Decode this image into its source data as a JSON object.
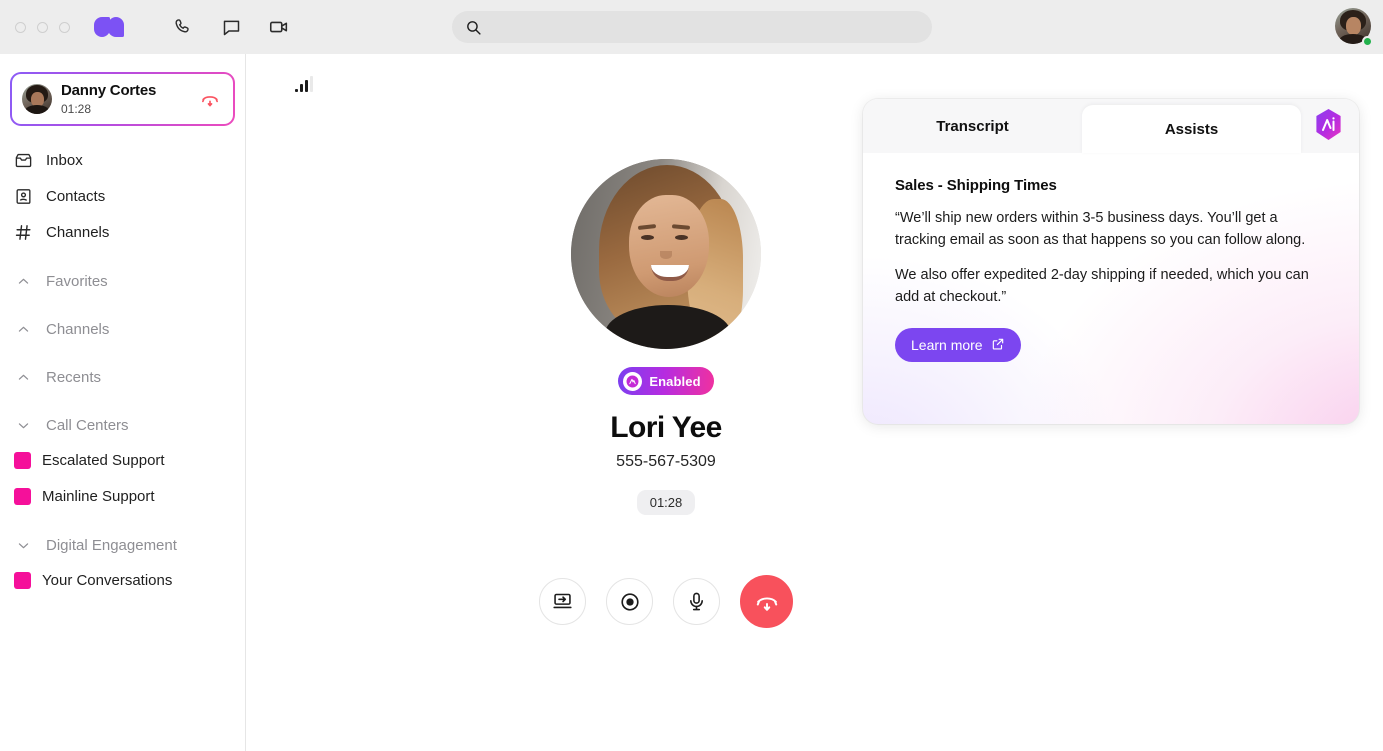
{
  "window": {
    "traffic_lights": [
      "close",
      "minimize",
      "zoom"
    ],
    "logo_name": "dialpad-logo"
  },
  "topbar": {
    "icons": [
      {
        "name": "phone-icon",
        "label": "Phone"
      },
      {
        "name": "message-icon",
        "label": "Messages"
      },
      {
        "name": "video-icon",
        "label": "Video"
      }
    ],
    "search": {
      "value": "",
      "placeholder": ""
    },
    "account": {
      "name": "account-avatar",
      "status": "online",
      "status_color": "#22b14c"
    }
  },
  "sidebar": {
    "active_call": {
      "name": "Danny Cortes",
      "duration": "01:28",
      "end_call_label": "End call"
    },
    "nav": [
      {
        "icon": "inbox-icon",
        "label": "Inbox"
      },
      {
        "icon": "contacts-icon",
        "label": "Contacts"
      },
      {
        "icon": "hash-icon",
        "label": "Channels"
      }
    ],
    "sections": [
      {
        "label": "Favorites",
        "state": "collapsed",
        "chevron": "chevron-up-icon",
        "items": []
      },
      {
        "label": "Channels",
        "state": "collapsed",
        "chevron": "chevron-up-icon",
        "items": []
      },
      {
        "label": "Recents",
        "state": "collapsed",
        "chevron": "chevron-up-icon",
        "items": []
      },
      {
        "label": "Call Centers",
        "state": "expanded",
        "chevron": "chevron-down-icon",
        "items": [
          {
            "label": "Escalated Support",
            "color": "#f5109a"
          },
          {
            "label": "Mainline Support",
            "color": "#f5109a"
          }
        ]
      },
      {
        "label": "Digital Engagement",
        "state": "expanded",
        "chevron": "chevron-down-icon",
        "items": [
          {
            "label": "Your Conversations",
            "color": "#f5109a"
          }
        ]
      }
    ]
  },
  "call": {
    "signal_icon": "signal-strength-icon",
    "signal_bars_filled": 3,
    "signal_bars_total": 4,
    "avatar_name": "caller-avatar",
    "badge": {
      "label": "Enabled",
      "icon": "ai-badge-icon"
    },
    "caller_name": "Lori Yee",
    "phone": "555-567-5309",
    "timer": "01:28",
    "controls": [
      {
        "name": "transfer-call-button",
        "icon": "screen-transfer-icon",
        "label": "Transfer"
      },
      {
        "name": "record-call-button",
        "icon": "record-icon",
        "label": "Record"
      },
      {
        "name": "mute-button",
        "icon": "microphone-icon",
        "label": "Mute"
      },
      {
        "name": "end-call-button",
        "icon": "hangup-icon",
        "label": "End call"
      }
    ]
  },
  "assist_panel": {
    "tabs": [
      {
        "label": "Transcript",
        "active": false
      },
      {
        "label": "Assists",
        "active": true
      }
    ],
    "ai_badge": "ai-hexagon-icon",
    "card": {
      "title": "Sales - Shipping Times",
      "paragraph_1": "“We’ll ship new orders within 3-5 business days. You’ll get a tracking email as soon as that happens so you can follow along.",
      "paragraph_2": "We also offer expedited 2-day shipping if needed, which you can add at checkout.”",
      "cta_label": "Learn more",
      "cta_icon": "external-link-icon"
    }
  },
  "colors": {
    "brand_purple": "#7c52f4",
    "accent_pink": "#f5109a",
    "danger_red": "#f8515c",
    "online_green": "#22b14c",
    "topbar_bg": "#ededed"
  }
}
